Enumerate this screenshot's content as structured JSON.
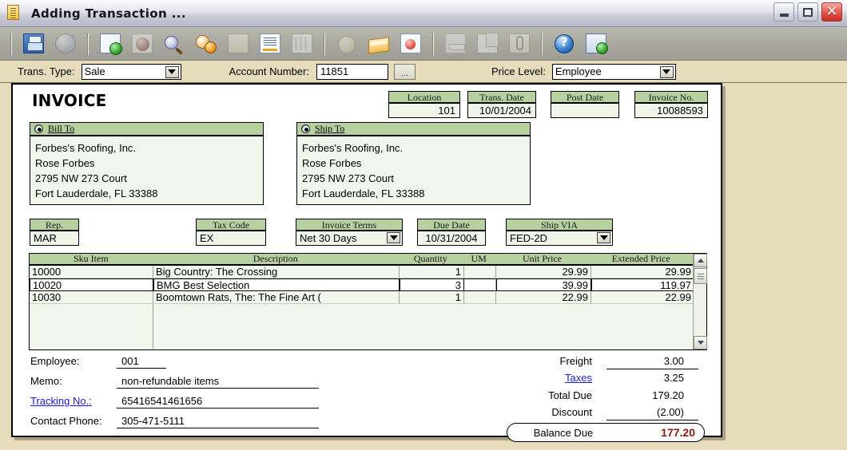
{
  "window": {
    "title": "Adding Transaction ...",
    "icon": "document-icon",
    "minimize_label": "",
    "maximize_label": "",
    "close_label": "✕"
  },
  "toolbar": {
    "buttons": [
      {
        "name": "save-button",
        "icon": "floppy-disk-icon",
        "enabled": true
      },
      {
        "name": "refresh-button",
        "icon": "blue-orb-icon",
        "enabled": false
      },
      {
        "name": "new-record-button",
        "icon": "new-document-icon",
        "enabled": true
      },
      {
        "name": "delete-record-button",
        "icon": "red-delete-icon",
        "enabled": false
      },
      {
        "name": "find-button",
        "icon": "magnifier-icon",
        "enabled": true
      },
      {
        "name": "verify-button",
        "icon": "magnifier-check-icon",
        "enabled": true
      },
      {
        "name": "open-folder-button",
        "icon": "folder-icon",
        "enabled": false
      },
      {
        "name": "notes-button",
        "icon": "document-lines-icon",
        "enabled": true
      },
      {
        "name": "report-button",
        "icon": "grid-report-icon",
        "enabled": false
      },
      {
        "name": "payment-button",
        "icon": "coin-icon",
        "enabled": false
      },
      {
        "name": "ledger-button",
        "icon": "book-icon",
        "enabled": true
      },
      {
        "name": "credit-card-button",
        "icon": "credit-card-icon",
        "enabled": true
      },
      {
        "name": "print-button",
        "icon": "printer-icon",
        "enabled": false
      },
      {
        "name": "copy-button",
        "icon": "copy-pages-icon",
        "enabled": false
      },
      {
        "name": "attach-button",
        "icon": "attachment-icon",
        "enabled": false
      },
      {
        "name": "help-button",
        "icon": "help-question-icon",
        "enabled": true
      },
      {
        "name": "exit-button",
        "icon": "exit-door-icon",
        "enabled": true
      }
    ]
  },
  "top_strip": {
    "trans_type_label": "Trans. Type:",
    "trans_type_value": "Sale",
    "account_number_label": "Account Number:",
    "account_number_value": "11851",
    "account_lookup_label": "...",
    "price_level_label": "Price Level:",
    "price_level_value": "Employee"
  },
  "invoice": {
    "title": "INVOICE",
    "header_fields": [
      {
        "name": "location",
        "label": "Location",
        "value": "101"
      },
      {
        "name": "trans-date",
        "label": "Trans. Date",
        "value": "10/01/2004"
      },
      {
        "name": "post-date",
        "label": "Post Date",
        "value": ""
      },
      {
        "name": "invoice-no",
        "label": "Invoice No.",
        "value": "10088593"
      }
    ],
    "bill_to": {
      "label": "Bill To",
      "lines": [
        "Forbes's Roofing, Inc.",
        "Rose Forbes",
        "2795 NW 273 Court",
        "Fort Lauderdale, FL 33388"
      ]
    },
    "ship_to": {
      "label": "Ship To",
      "lines": [
        "Forbes's Roofing, Inc.",
        "Rose Forbes",
        "2795 NW 273 Court",
        "Fort Lauderdale, FL 33388"
      ]
    },
    "detail_fields": {
      "rep": {
        "label": "Rep.",
        "value": "MAR"
      },
      "tax_code": {
        "label": "Tax Code",
        "value": "EX"
      },
      "invoice_terms": {
        "label": "Invoice Terms",
        "value": "Net 30 Days"
      },
      "due_date": {
        "label": "Due Date",
        "value": "10/31/2004"
      },
      "ship_via": {
        "label": "Ship VIA",
        "value": "FED-2D"
      }
    },
    "line_items": {
      "columns": [
        "Sku Item",
        "Description",
        "Quantity",
        "UM",
        "Unit Price",
        "Extended Price"
      ],
      "rows": [
        {
          "sku": "10000",
          "description": "Big Country: The Crossing",
          "quantity": "1",
          "um": "",
          "unit_price": "29.99",
          "extended_price": "29.99",
          "selected": false
        },
        {
          "sku": "10020",
          "description": "BMG Best Selection",
          "quantity": "3",
          "um": "",
          "unit_price": "39.99",
          "extended_price": "119.97",
          "selected": true
        },
        {
          "sku": "10030",
          "description": "Boomtown Rats, The: The Fine Art (",
          "quantity": "1",
          "um": "",
          "unit_price": "22.99",
          "extended_price": "22.99",
          "selected": false
        }
      ]
    },
    "footer_fields": [
      {
        "name": "employee",
        "label": "Employee:",
        "value": "001",
        "link": false
      },
      {
        "name": "memo",
        "label": "Memo:",
        "value": "non-refundable items",
        "link": false
      },
      {
        "name": "tracking-no",
        "label": "Tracking No.:",
        "value": "65416541461656",
        "link": true
      },
      {
        "name": "contact-phone",
        "label": "Contact Phone:",
        "value": "305-471-5111",
        "link": false
      }
    ],
    "totals": [
      {
        "name": "freight",
        "label": "Freight",
        "value": "3.00",
        "link": false
      },
      {
        "name": "taxes",
        "label": "Taxes",
        "value": "3.25",
        "link": true
      },
      {
        "name": "total-due",
        "label": "Total Due",
        "value": "179.20",
        "link": false
      },
      {
        "name": "discount",
        "label": "Discount",
        "value": "(2.00)",
        "link": false
      }
    ],
    "balance_due": {
      "label": "Balance Due",
      "value": "177.20"
    }
  },
  "colors": {
    "header_green": "#b6d0a0",
    "field_green": "#eff5e9",
    "form_bg": "#e6dcbc",
    "toolbar_gray": "#a9a9a0",
    "link_blue": "#1a1ad0",
    "balance_red": "#8b1a14"
  }
}
